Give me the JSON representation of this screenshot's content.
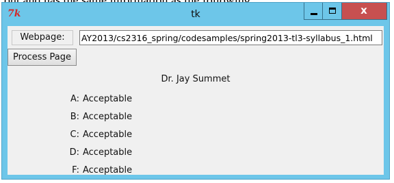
{
  "snippet_text": "out and has the same information as the following:",
  "window": {
    "title": "tk",
    "icon": "tk-feather-icon",
    "controls": {
      "minimize": "minimize-icon",
      "maximize": "maximize-icon",
      "close_glyph": "x"
    }
  },
  "form": {
    "webpage_label": "Webpage:",
    "url_value": "AY2013/cs2316_spring/codesamples/spring2013-tl3-syllabus_1.html",
    "process_label": "Process Page"
  },
  "result": {
    "instructor": "Dr. Jay Summet",
    "grades": [
      {
        "letter": "A:",
        "value": "Acceptable"
      },
      {
        "letter": "B:",
        "value": "Acceptable"
      },
      {
        "letter": "C:",
        "value": "Acceptable"
      },
      {
        "letter": "D:",
        "value": "Acceptable"
      },
      {
        "letter": "F:",
        "value": "Acceptable"
      }
    ]
  },
  "colors": {
    "window_frame": "#6dc6e9",
    "close_button": "#c75050",
    "client_bg": "#f0f0f0"
  }
}
